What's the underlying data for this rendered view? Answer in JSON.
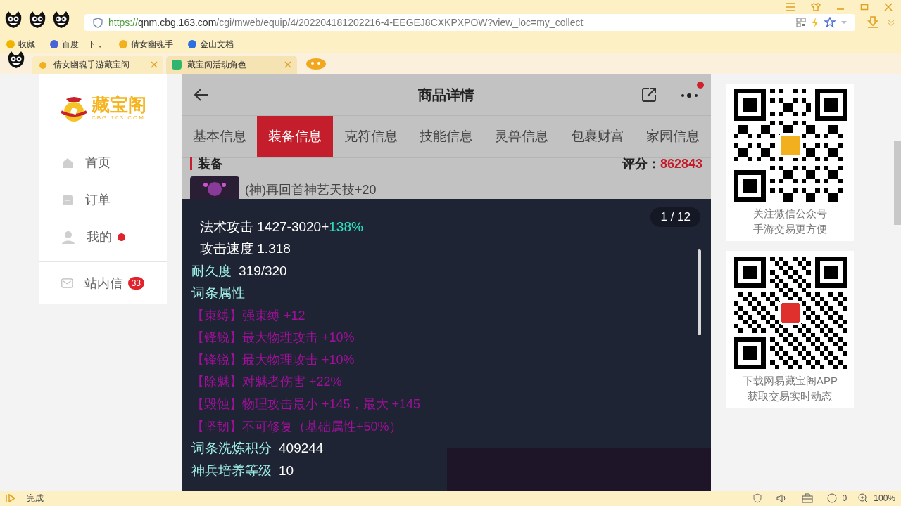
{
  "browser": {
    "url": {
      "scheme": "https://",
      "host": "qnm.cbg.163.com",
      "path": "/cgi/mweb/equip/4/202204181202216-4-EEGEJ8CXKPXPOW?view_loc=my_collect"
    },
    "bookmarks": [
      "收藏",
      "百度一下，",
      "倩女幽魂手",
      "金山文档"
    ],
    "tabs": [
      {
        "label": "倩女幽魂手游藏宝阁",
        "selected": true
      },
      {
        "label": "藏宝阁活动角色",
        "selected": false
      }
    ]
  },
  "sidebar": {
    "logo": "藏宝阁",
    "logo_sub": "CBG.163.COM",
    "items": [
      {
        "label": "首页",
        "kind": "home",
        "dot": false
      },
      {
        "label": "订单",
        "kind": "order",
        "dot": false
      },
      {
        "label": "我的",
        "kind": "user",
        "dot": true
      },
      {
        "label": "站内信",
        "kind": "mail",
        "dot": false,
        "badge": "33"
      }
    ]
  },
  "detail": {
    "title": "商品详情",
    "tabs": [
      {
        "label": "基本信息",
        "selected": false
      },
      {
        "label": "装备信息",
        "selected": true
      },
      {
        "label": "克符信息",
        "selected": false
      },
      {
        "label": "技能信息",
        "selected": false
      },
      {
        "label": "灵兽信息",
        "selected": false
      },
      {
        "label": "包裹财富",
        "selected": false
      },
      {
        "label": "家园信息",
        "selected": false
      }
    ],
    "section": "装备",
    "score_label": "评分：",
    "score": "862843",
    "item": "(神)再回首神艺天技+20"
  },
  "popup": {
    "counter": "1 / 12",
    "lines": [
      {
        "kind": "stat",
        "label": "法术攻击",
        "value": "1427-3020+",
        "extra": "138%"
      },
      {
        "kind": "stat",
        "label": "攻击速度",
        "value": "1.318"
      },
      {
        "kind": "field",
        "label": "耐久度",
        "value": "319/320"
      },
      {
        "kind": "heading",
        "label": "词条属性"
      },
      {
        "kind": "affix",
        "label": "【束缚】强束缚 +12"
      },
      {
        "kind": "affix",
        "label": "【锋锐】最大物理攻击 +10%"
      },
      {
        "kind": "affix",
        "label": "【锋锐】最大物理攻击 +10%"
      },
      {
        "kind": "affix",
        "label": "【除魅】对魅者伤害 +22%"
      },
      {
        "kind": "affix",
        "label": "【毁蚀】物理攻击最小 +145，最大 +145"
      },
      {
        "kind": "affix",
        "label": "【坚韧】不可修复（基础属性+50%）"
      },
      {
        "kind": "field",
        "label": "词条洗炼积分",
        "value": "409244"
      },
      {
        "kind": "field",
        "label": "神兵培养等级",
        "value": "10"
      }
    ]
  },
  "qr_cards": [
    {
      "caption": [
        "关注微信公众号",
        "手游交易更方便"
      ]
    },
    {
      "caption": [
        "下载网易藏宝阁APP",
        "获取交易实时动态"
      ]
    }
  ],
  "status_bar": {
    "text": "完成",
    "count": "0",
    "zoom": "100%"
  }
}
